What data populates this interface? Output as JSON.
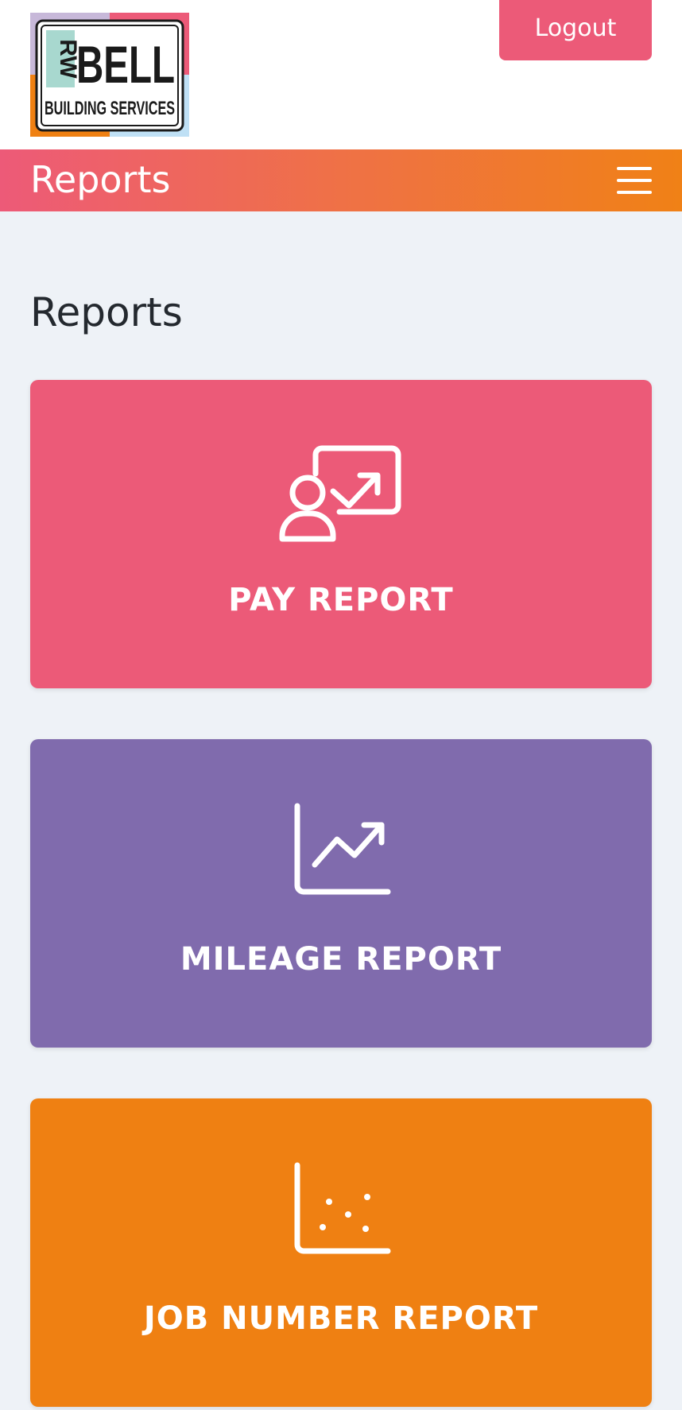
{
  "header": {
    "logo": {
      "line1": "RW",
      "line2": "BELL",
      "line3": "BUILDING SERVICES"
    },
    "logout_label": "Logout"
  },
  "navbar": {
    "title": "Reports",
    "menu_icon": "hamburger-icon"
  },
  "main": {
    "title": "Reports",
    "cards": [
      {
        "label": "PAY REPORT",
        "icon": "person-chart-icon",
        "color": "#ec5a78"
      },
      {
        "label": "MILEAGE REPORT",
        "icon": "line-chart-icon",
        "color": "#806bad"
      },
      {
        "label": "JOB NUMBER REPORT",
        "icon": "scatter-chart-icon",
        "color": "#ef8012"
      }
    ]
  },
  "colors": {
    "accent_pink": "#ec5a78",
    "accent_orange": "#f08116",
    "background": "#eef2f7"
  }
}
